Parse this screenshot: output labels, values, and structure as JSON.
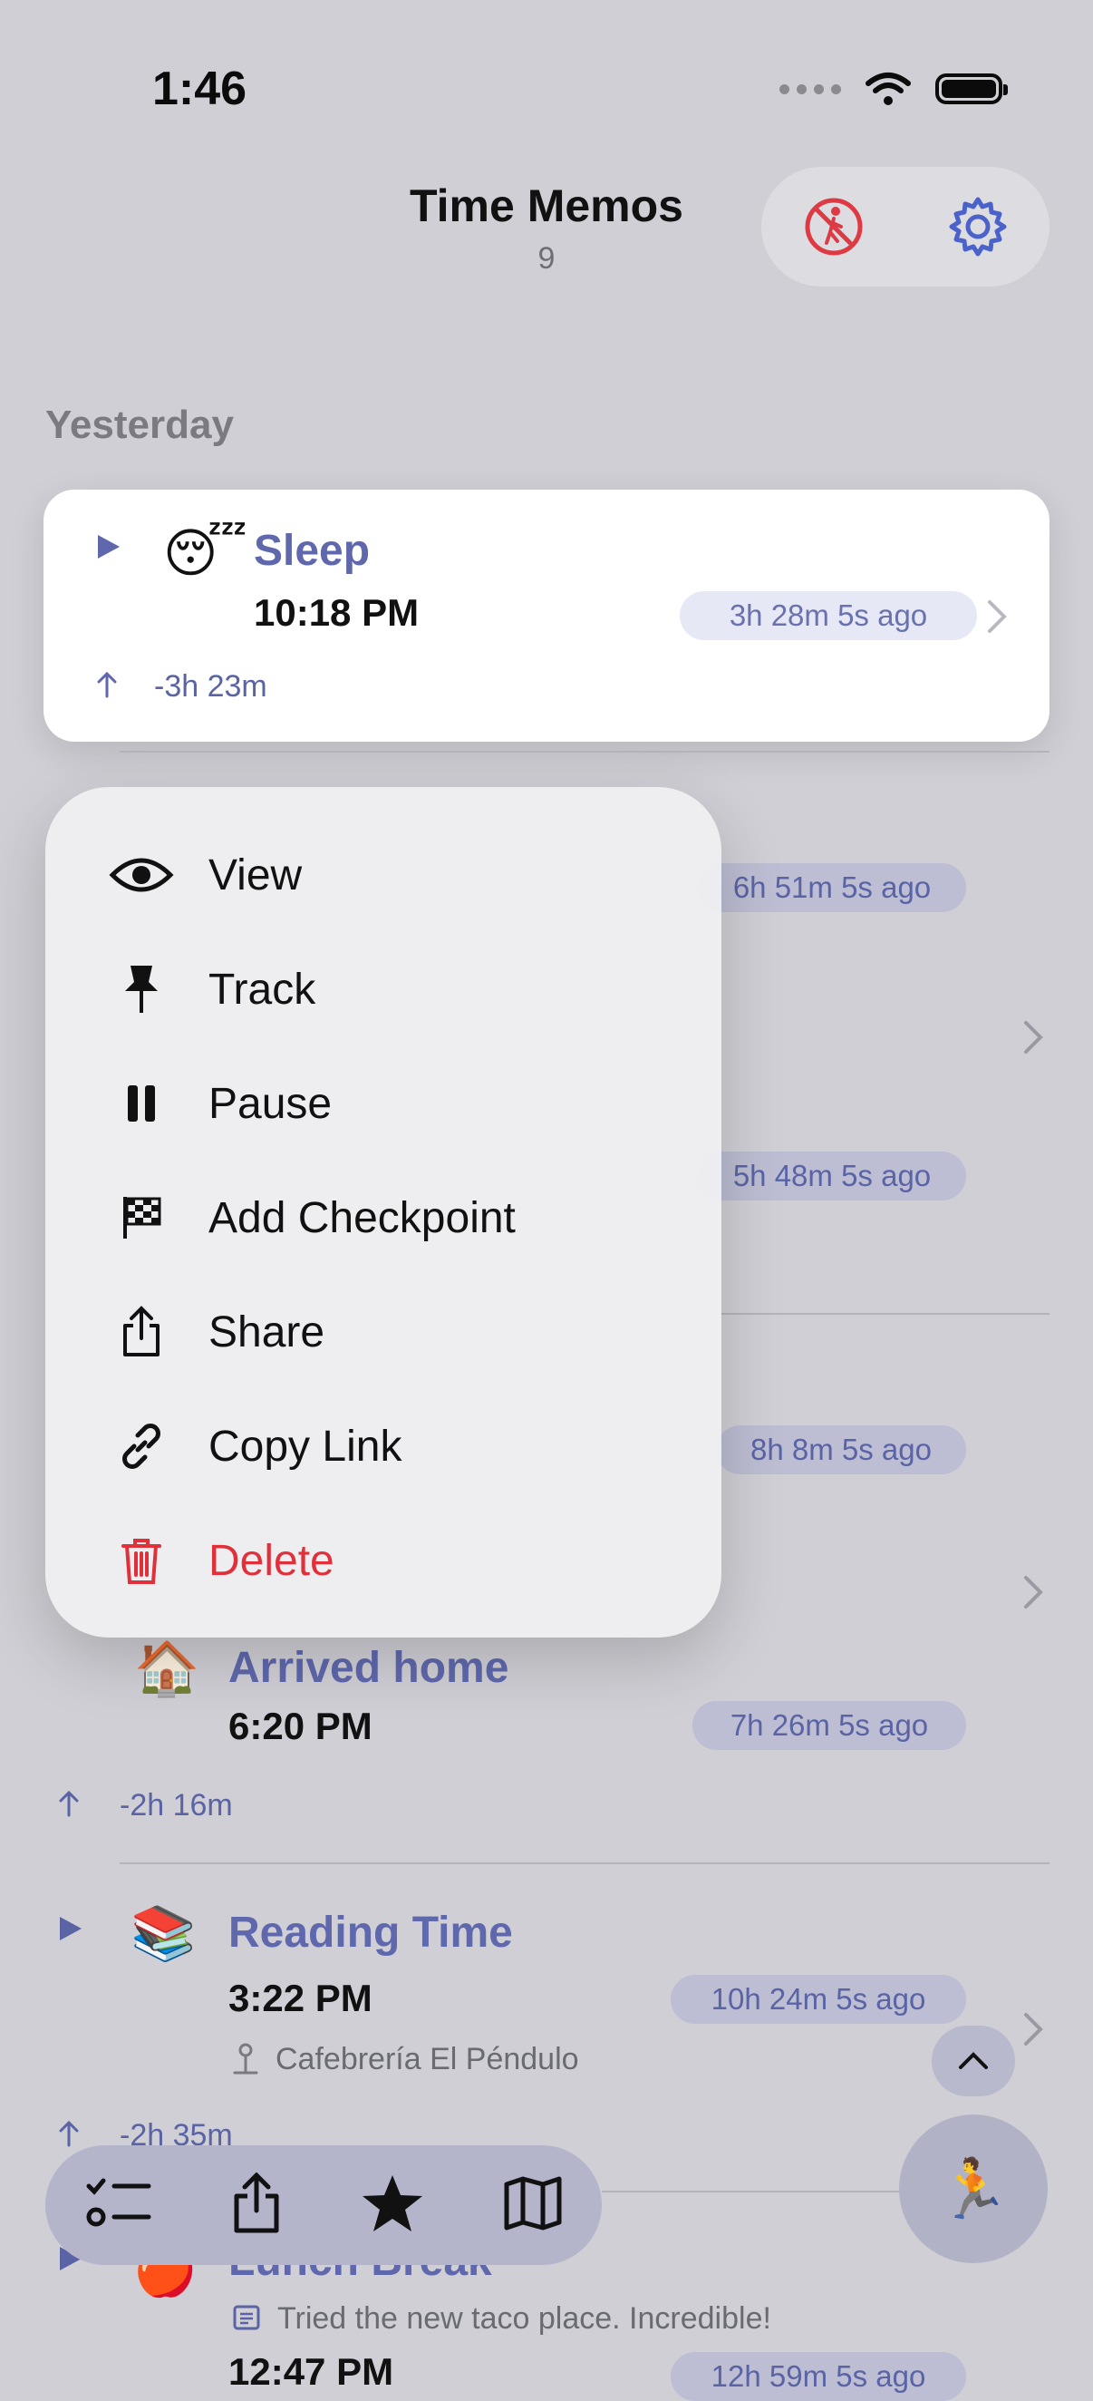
{
  "status_bar": {
    "time": "1:46"
  },
  "header": {
    "title": "Time Memos",
    "count": "9"
  },
  "section_label": "Yesterday",
  "focused_card": {
    "emoji": "😴",
    "name": "Sleep",
    "time": "10:18 PM",
    "ago": "3h 28m 5s ago",
    "delta": "-3h 23m"
  },
  "background_rows": [
    {
      "ago": "6h 51m 5s ago"
    },
    {
      "ago": "5h 48m 5s ago"
    },
    {
      "ago": "8h 8m 5s ago"
    },
    {
      "emoji": "🏠",
      "name": "Arrived home",
      "time": "6:20 PM",
      "ago": "7h 26m 5s ago",
      "delta": "-2h 16m"
    },
    {
      "emoji": "📚",
      "name": "Reading Time",
      "time": "3:22 PM",
      "ago": "10h 24m 5s ago",
      "location": "Cafebrería El Péndulo",
      "delta": "-2h 35m"
    },
    {
      "emoji": "🍎",
      "name": "Lunch Break",
      "note": "Tried the new taco place. Incredible!",
      "time": "12:47 PM",
      "ago": "12h 59m 5s ago"
    }
  ],
  "context_menu": [
    {
      "label": "View",
      "icon": "eye-icon"
    },
    {
      "label": "Track",
      "icon": "pin-icon"
    },
    {
      "label": "Pause",
      "icon": "pause-icon"
    },
    {
      "label": "Add Checkpoint",
      "icon": "checkered-flag-icon"
    },
    {
      "label": "Share",
      "icon": "share-icon"
    },
    {
      "label": "Copy Link",
      "icon": "link-icon"
    },
    {
      "label": "Delete",
      "icon": "trash-icon"
    }
  ],
  "fab_emoji": "🏃",
  "colors": {
    "accent": "#5f68ad",
    "danger": "#e0313b",
    "settings_blue": "#4a62c9"
  }
}
